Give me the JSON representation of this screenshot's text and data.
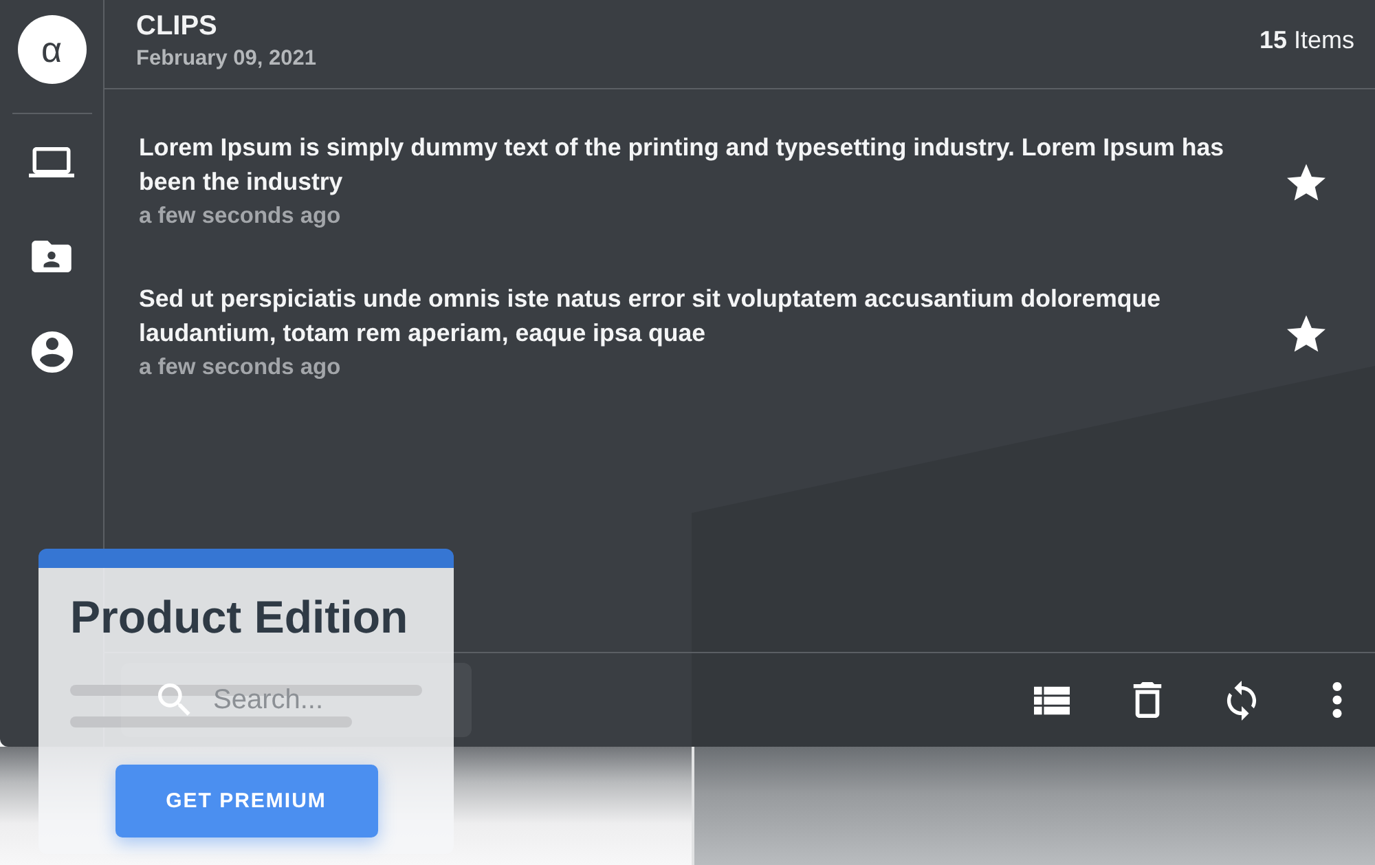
{
  "sidebar": {
    "avatar": "α"
  },
  "header": {
    "title": "CLIPS",
    "date": "February 09, 2021",
    "count": "**15** Items"
  },
  "clips": [
    {
      "text": "Lorem Ipsum is simply dummy text of the printing and typesetting industry. Lorem Ipsum has been the industry",
      "time": "a few seconds ago",
      "starred": true
    },
    {
      "text": "Sed ut perspiciatis unde omnis iste natus error sit voluptatem accusantium doloremque laudantium, totam rem aperiam, eaque ipsa quae",
      "time": "a few seconds ago",
      "starred": true
    }
  ],
  "search": {
    "placeholder": "Search..."
  },
  "promo_card": {
    "title": "Product Edition",
    "button": "GET PREMIUM"
  }
}
